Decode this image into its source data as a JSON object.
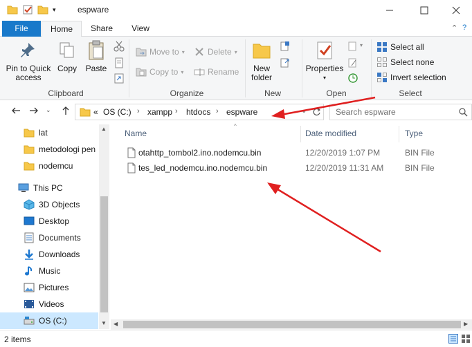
{
  "window": {
    "title": "espware",
    "controls": [
      "minimize",
      "maximize",
      "close"
    ]
  },
  "ribbon_tabs": {
    "file": "File",
    "home": "Home",
    "share": "Share",
    "view": "View"
  },
  "ribbon": {
    "clipboard": {
      "label": "Clipboard",
      "pin_to_quick_access": "Pin to Quick access",
      "copy": "Copy",
      "paste": "Paste"
    },
    "organize": {
      "label": "Organize",
      "move_to": "Move to",
      "copy_to": "Copy to",
      "delete": "Delete",
      "rename": "Rename"
    },
    "new": {
      "label": "New",
      "new_folder": "New folder"
    },
    "open": {
      "label": "Open",
      "properties": "Properties"
    },
    "select": {
      "label": "Select",
      "select_all": "Select all",
      "select_none": "Select none",
      "invert_selection": "Invert selection"
    }
  },
  "address_bar": {
    "overflow": "«",
    "breadcrumbs": [
      "OS (C:)",
      "xampp",
      "htdocs",
      "espware"
    ],
    "search_placeholder": "Search espware"
  },
  "nav_pane": {
    "items": [
      {
        "label": "lat",
        "icon": "folder-icon"
      },
      {
        "label": "metodologi pen",
        "icon": "folder-icon"
      },
      {
        "label": "nodemcu",
        "icon": "folder-icon"
      },
      {
        "label": "This PC",
        "icon": "computer-icon"
      },
      {
        "label": "3D Objects",
        "icon": "3d-objects-icon"
      },
      {
        "label": "Desktop",
        "icon": "desktop-icon"
      },
      {
        "label": "Documents",
        "icon": "documents-icon"
      },
      {
        "label": "Downloads",
        "icon": "downloads-icon"
      },
      {
        "label": "Music",
        "icon": "music-icon"
      },
      {
        "label": "Pictures",
        "icon": "pictures-icon"
      },
      {
        "label": "Videos",
        "icon": "videos-icon"
      },
      {
        "label": "OS (C:)",
        "icon": "drive-icon"
      }
    ]
  },
  "file_list": {
    "columns": {
      "name": "Name",
      "date": "Date modified",
      "type": "Type"
    },
    "rows": [
      {
        "name": "otahttp_tombol2.ino.nodemcu.bin",
        "date": "12/20/2019 1:07 PM",
        "type": "BIN File"
      },
      {
        "name": "tes_led_nodemcu.ino.nodemcu.bin",
        "date": "12/20/2019 11:31 AM",
        "type": "BIN File"
      }
    ]
  },
  "status_bar": {
    "item_count": "2 items"
  },
  "colors": {
    "accent": "#1979ca",
    "selection": "#cce8ff",
    "annotation_arrow": "#e02020"
  }
}
